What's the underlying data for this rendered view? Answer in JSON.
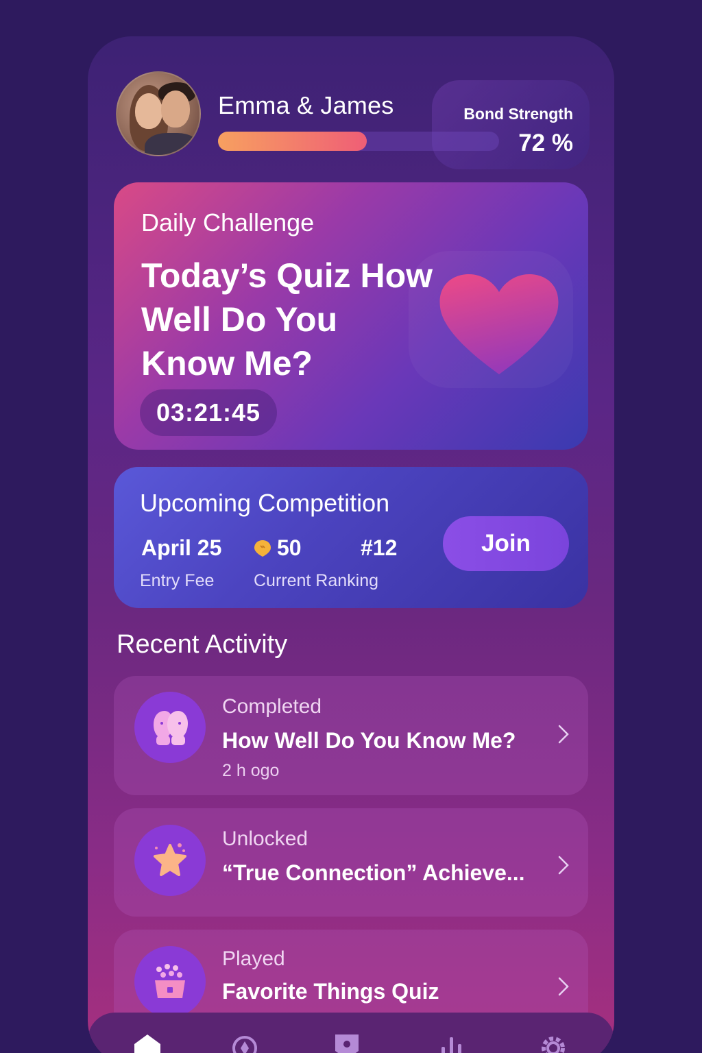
{
  "header": {
    "couple_name": "Emma & James",
    "bond_label": "Bond Strength",
    "bond_value": "72 %",
    "bond_fraction": 0.53
  },
  "daily": {
    "label": "Daily Challenge",
    "title": "Today’s Quiz How Well Do You Know Me?",
    "timer": "03:21:45",
    "icon": "heart-icon"
  },
  "competition": {
    "title": "Upcoming Competition",
    "date": "April 25",
    "fee_label": "Entry Fee",
    "fee": "50",
    "rank": "#12",
    "rank_label": "Current Ranking",
    "join": "Join"
  },
  "recent": {
    "title": "Recent Activity",
    "items": [
      {
        "kind": "Completed",
        "main": "How Well Do You Know Me?",
        "time": "2 h ogo",
        "icon": "couple-faces-icon"
      },
      {
        "kind": "Unlocked",
        "main": "“True Connection” Achieve...",
        "time": "",
        "icon": "star-icon"
      },
      {
        "kind": "Played",
        "main": "Favorite Things Quiz",
        "time": "",
        "icon": "popcorn-icon"
      }
    ]
  },
  "nav": [
    "home-icon",
    "compass-icon",
    "map-pin-icon",
    "stats-icon",
    "settings-icon"
  ],
  "colors": {
    "background": "#2e1a5e",
    "accent_gradient_start": "#f7a060",
    "accent_gradient_end": "#ef5e76",
    "join_button": "#8b4ee6"
  }
}
